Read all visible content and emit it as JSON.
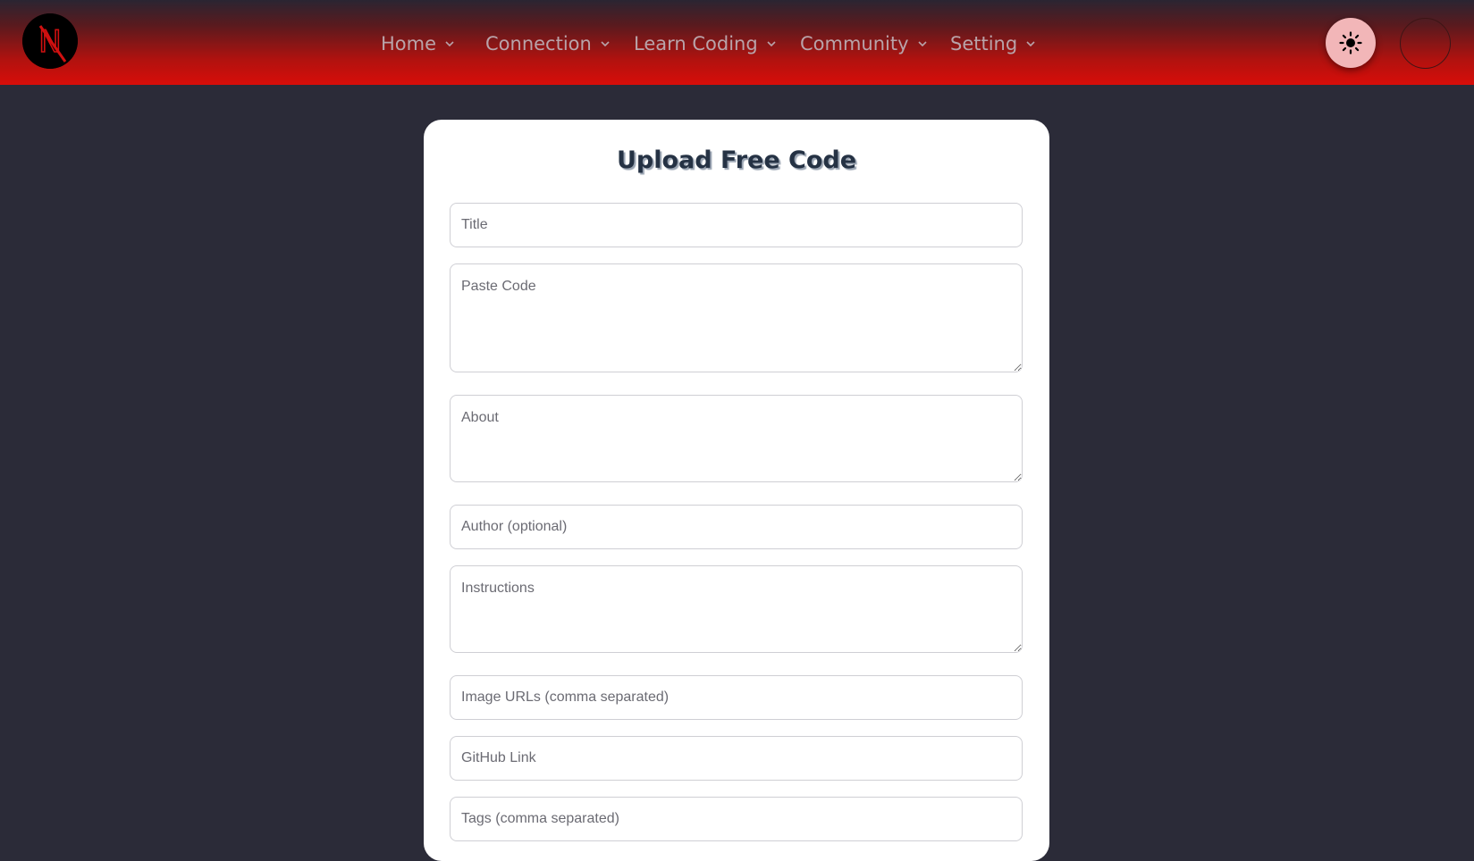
{
  "navbar": {
    "logo_letter": "N",
    "items": [
      {
        "label": "Home"
      },
      {
        "label": "Connection"
      },
      {
        "label": "Learn Coding"
      },
      {
        "label": "Community"
      },
      {
        "label": "Setting"
      }
    ],
    "theme_icon": "sun-icon",
    "chevron_icon": "chevron-down-icon"
  },
  "form": {
    "title": "Upload Free Code",
    "fields": {
      "title": {
        "placeholder": "Title",
        "value": ""
      },
      "code": {
        "placeholder": "Paste Code",
        "value": ""
      },
      "about": {
        "placeholder": "About",
        "value": ""
      },
      "author": {
        "placeholder": "Author (optional)",
        "value": ""
      },
      "instructions": {
        "placeholder": "Instructions",
        "value": ""
      },
      "image_urls": {
        "placeholder": "Image URLs (comma separated)",
        "value": ""
      },
      "github": {
        "placeholder": "GitHub Link",
        "value": ""
      },
      "tags": {
        "placeholder": "Tags (comma separated)",
        "value": ""
      }
    }
  },
  "colors": {
    "nav_gradient_top": "#2a2532",
    "nav_gradient_bottom": "#d80d09",
    "page_background": "#2b2b38",
    "nav_text": "#b9a3a9",
    "title_text": "#253244",
    "theme_button": "#f2b6b8"
  }
}
